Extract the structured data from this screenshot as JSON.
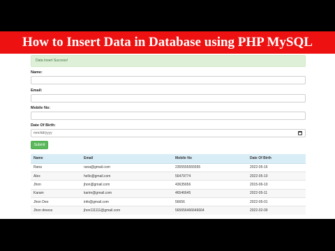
{
  "banner": {
    "title": "How to Insert Data in Database using PHP MySQL"
  },
  "alert": {
    "message": "Data Insert Success!"
  },
  "form": {
    "name_label": "Name:",
    "email_label": "Email:",
    "mobile_label": "Mobile No:",
    "dob_label": "Date Of Birth:",
    "dob_placeholder": "mm/dd/yyyy",
    "submit_label": "Submit"
  },
  "table": {
    "headers": [
      "Name",
      "Email",
      "Mobile No",
      "Date Of Birth"
    ],
    "rows": [
      [
        "Rana",
        "rana@gmail.com",
        "2355555555555",
        "2022-05-16"
      ],
      [
        "Alex",
        "hello@gmail.com",
        "56479774",
        "2022-05-10"
      ],
      [
        "Jhon",
        "jhon@gmail.com",
        "43635656",
        "2015-06-10"
      ],
      [
        "Karam",
        "karim@gmail.com",
        "46546645",
        "2022-05-11"
      ],
      [
        "Jhon Deo",
        "info@gmail.com",
        "56656",
        "2022-05-01"
      ],
      [
        "Jhon dreess",
        "jhon111111@gmail.com",
        "565656466646664",
        "2022-02-09"
      ]
    ]
  }
}
